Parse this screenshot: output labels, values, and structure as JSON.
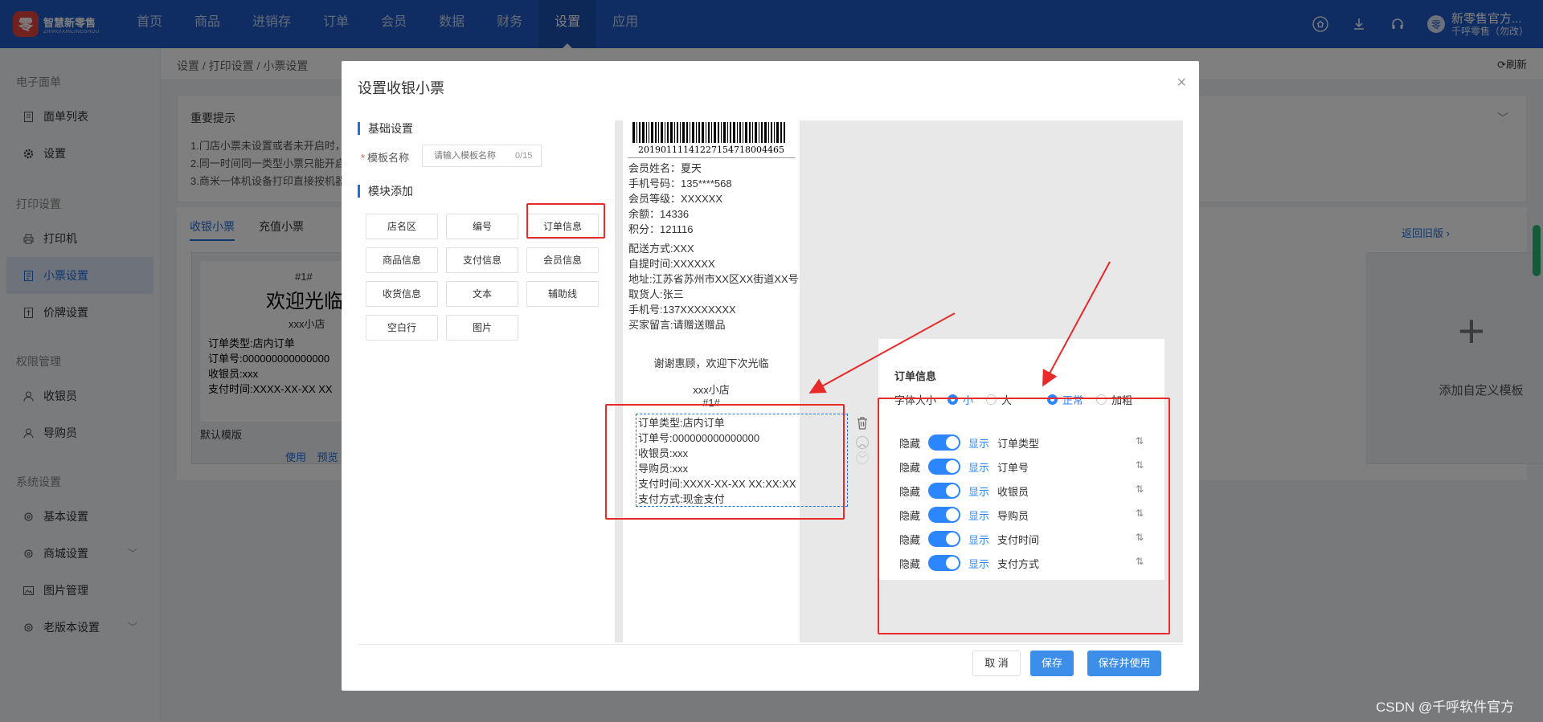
{
  "header": {
    "logo_mark": "零",
    "logo_title": "智慧新零售",
    "logo_subtitle": "ZHIHUIXINLINGSHOU",
    "nav": [
      "首页",
      "商品",
      "进销存",
      "订单",
      "会员",
      "数据",
      "财务",
      "设置",
      "应用"
    ],
    "active_nav": "设置",
    "user_name": "新零售官方...",
    "user_sub": "千呼零售（勿改）",
    "user_avatar": "零"
  },
  "sidebar": {
    "groups": [
      {
        "title": "电子面单",
        "items": [
          "面单列表",
          "设置"
        ]
      },
      {
        "title": "打印设置",
        "items": [
          "打印机",
          "小票设置",
          "价牌设置"
        ]
      },
      {
        "title": "权限管理",
        "items": [
          "收银员",
          "导购员"
        ]
      },
      {
        "title": "系统设置",
        "items": [
          "基本设置",
          "商城设置",
          "图片管理",
          "老版本设置"
        ]
      }
    ],
    "active_item": "小票设置"
  },
  "page": {
    "breadcrumb": "设置 / 打印设置 / 小票设置",
    "refresh": "刷新",
    "tip_title": "重要提示",
    "tip_lines": [
      "1.门店小票未设置或者未开启时，",
      "2.同一时间同一类型小票只能开启",
      "3.商米一体机设备打印直接按机器"
    ],
    "tabs": [
      "收银小票",
      "充值小票"
    ],
    "return_old": "返回旧版 ›",
    "template": {
      "no": "#1#",
      "welcome": "欢迎光临",
      "shop": "xxx小店",
      "lines": [
        "订单类型:店内订单",
        "订单号:000000000000000",
        "收银员:xxx",
        "支付时间:XXXX-XX-XX XX"
      ],
      "label": "默认模版",
      "use": "使用",
      "preview": "预览"
    },
    "add_template": "添加自定义模板",
    "watermark": "CSDN @千呼软件官方"
  },
  "modal": {
    "title": "设置收银小票",
    "basic_settings": "基础设置",
    "template_name_label": "模板名称",
    "template_name_placeholder": "请输入模板名称",
    "template_name_count": "0/15",
    "module_add": "模块添加",
    "modules": [
      "店名区",
      "编号",
      "订单信息",
      "商品信息",
      "支付信息",
      "会员信息",
      "收货信息",
      "文本",
      "辅助线",
      "空白行",
      "图片"
    ],
    "receipt": {
      "barcode_number": "20190111141227154718004465",
      "member_lines": [
        "会员姓名：夏天",
        "手机号码：135****568",
        "会员等级：XXXXXX",
        "余额：14336",
        "积分：121116"
      ],
      "delivery_lines": [
        "配送方式:XXX",
        "自提时间:XXXXXX",
        "地址:江苏省苏州市XX区XX街道XX号",
        "取货人:张三",
        "手机号:137XXXXXXXX",
        "买家留言:请赠送赠品"
      ],
      "thanks": "谢谢惠顾，欢迎下次光临",
      "shop": "xxx小店",
      "no": "#1#",
      "order_lines": [
        "订单类型:店内订单",
        "订单号:000000000000000",
        "收银员:xxx",
        "导购员:xxx",
        "支付时间:XXXX-XX-XX XX:XX:XX",
        "支付方式:现金支付"
      ]
    },
    "config": {
      "title": "订单信息",
      "font_size_label": "字体大小",
      "size_small": "小",
      "size_large": "大",
      "weight_normal": "正常",
      "weight_bold": "加粗",
      "hide": "隐藏",
      "show": "显示",
      "fields": [
        "订单类型",
        "订单号",
        "收银员",
        "导购员",
        "支付时间",
        "支付方式"
      ]
    },
    "cancel": "取 消",
    "save": "保存",
    "save_use": "保存并使用"
  },
  "colors": {
    "primary": "#1f6fe0",
    "header": "#1f5bc4",
    "highlight": "#e82a2a"
  }
}
